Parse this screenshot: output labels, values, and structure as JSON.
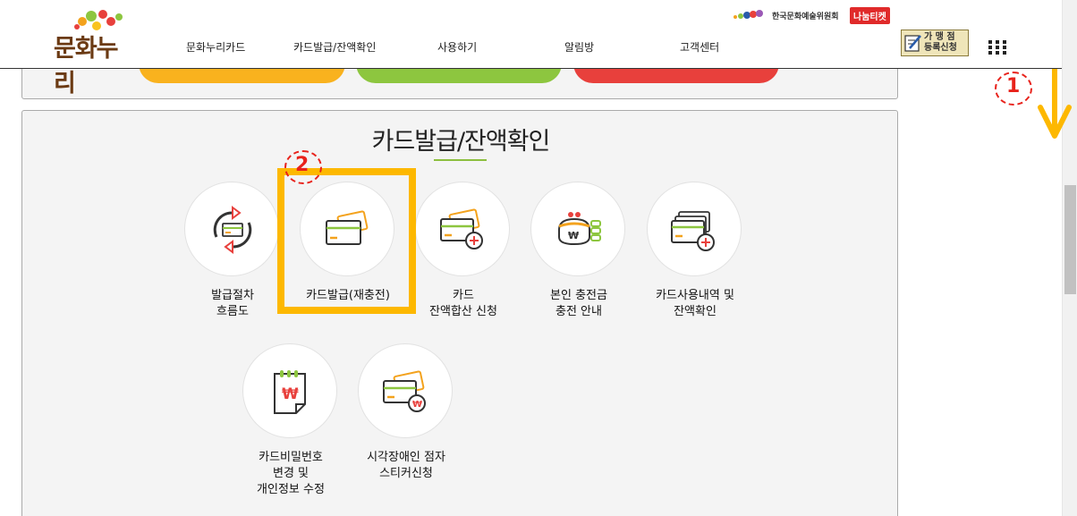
{
  "header": {
    "logo_text": "문화누리",
    "nav": [
      {
        "label": "문화누리카드"
      },
      {
        "label": "카드발급/잔액확인"
      },
      {
        "label": "사용하기"
      },
      {
        "label": "알림방"
      },
      {
        "label": "고객센터"
      }
    ],
    "org_name": "한국문화예술위원회",
    "nanum_ticket": "나눔티켓",
    "franchise_line1": "가 맹 점",
    "franchise_line2": "등록신청"
  },
  "section": {
    "title": "카드발급/잔액확인",
    "items": [
      {
        "label": "발급절차\n흐름도",
        "icon": "refresh-card-icon"
      },
      {
        "label": "카드발급(재충전)",
        "icon": "card-icon"
      },
      {
        "label": "카드\n잔액합산 신청",
        "icon": "card-plus-icon"
      },
      {
        "label": "본인 충전금\n충전 안내",
        "icon": "wallet-won-icon"
      },
      {
        "label": "카드사용내역 및\n잔액확인",
        "icon": "card-history-icon"
      },
      {
        "label": "카드비밀번호\n변경 및\n개인정보 수정",
        "icon": "notepad-won-icon"
      },
      {
        "label": "시각장애인 점자\n스티커신청",
        "icon": "card-won-icon"
      }
    ]
  },
  "annotations": {
    "step1": "1",
    "step2": "2",
    "color": "#e8221b",
    "highlight_color": "#fdb800"
  },
  "colors": {
    "bar_orange": "#f9b21e",
    "bar_green": "#8dc63f",
    "bar_red": "#e8403c",
    "title_underline": "#8cbf3f"
  }
}
